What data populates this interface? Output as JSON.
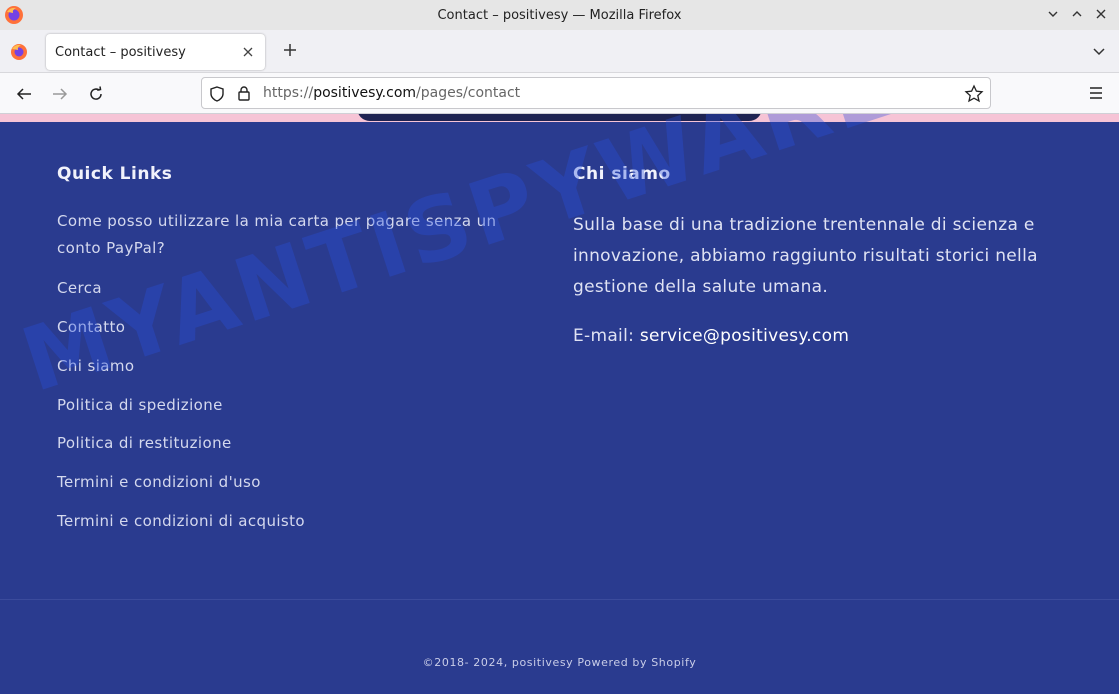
{
  "window": {
    "title": "Contact – positivesy — Mozilla Firefox"
  },
  "tab": {
    "title": "Contact – positivesy"
  },
  "urlbar": {
    "scheme": "https://",
    "domain": "positivesy.com",
    "path": "/pages/contact"
  },
  "quick_links": {
    "heading": "Quick Links",
    "items": [
      "Come posso utilizzare la mia carta per pagare senza un",
      "conto PayPal?",
      "Cerca",
      "Contatto",
      "Chi siamo",
      "Politica di spedizione",
      "Politica di restituzione",
      "Termini e condizioni d'uso",
      "Termini e condizioni di acquisto"
    ]
  },
  "about": {
    "heading": "Chi siamo",
    "text": "Sulla base di una tradizione trentennale di scienza e innovazione, abbiamo raggiunto risultati storici nella gestione della salute umana.",
    "email_label": "E-mail: ",
    "email": "service@positivesy.com"
  },
  "footer": {
    "text": "©2018- 2024, positivesy Powered by Shopify"
  },
  "watermark": "MYANTISPYWARE.COM",
  "colors": {
    "footer_bg": "#2a3b8f",
    "accent_pink": "#f6c4d6"
  }
}
